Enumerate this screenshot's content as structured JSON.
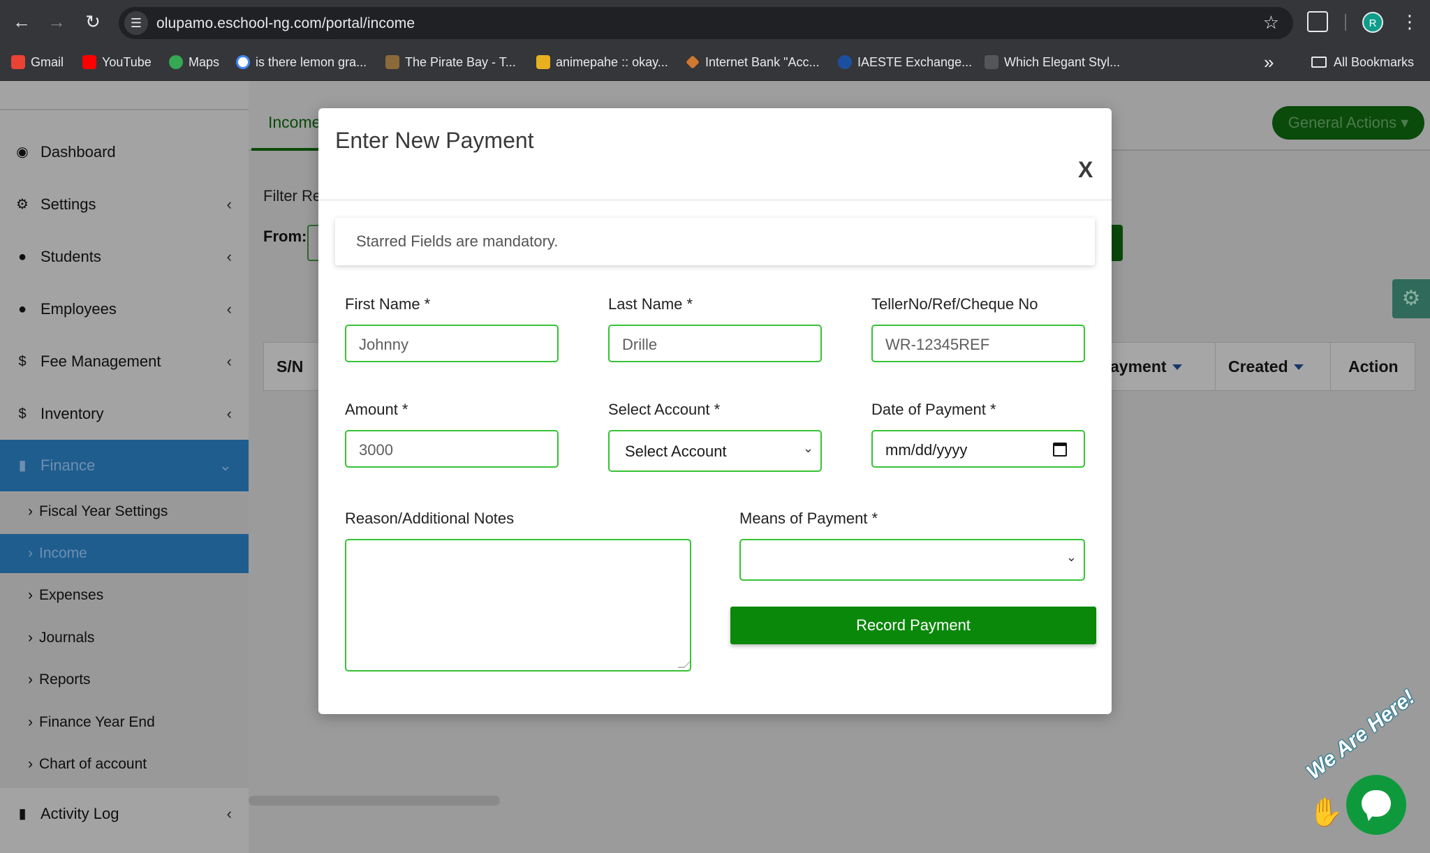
{
  "browser": {
    "url": "olupamo.eschool-ng.com/portal/income",
    "profile_initial": "R",
    "bookmarks": [
      {
        "label": "Gmail"
      },
      {
        "label": "YouTube"
      },
      {
        "label": "Maps"
      },
      {
        "label": "is there lemon gra..."
      },
      {
        "label": "The Pirate Bay - T..."
      },
      {
        "label": "animepahe :: okay..."
      },
      {
        "label": "Internet Bank \"Acc..."
      },
      {
        "label": "IAESTE Exchange..."
      },
      {
        "label": "Which Elegant Styl..."
      }
    ],
    "all_bookmarks": "All Bookmarks"
  },
  "sidebar": {
    "items": [
      {
        "label": "Dashboard",
        "icon": "dashboard-icon"
      },
      {
        "label": "Settings",
        "icon": "gear-icon"
      },
      {
        "label": "Students",
        "icon": "user-icon"
      },
      {
        "label": "Employees",
        "icon": "user-icon"
      },
      {
        "label": "Fee Management",
        "icon": "dollar-icon"
      },
      {
        "label": "Inventory",
        "icon": "dollar-icon"
      },
      {
        "label": "Finance",
        "icon": "book-icon"
      },
      {
        "label": "Activity Log",
        "icon": "book-icon"
      }
    ],
    "finance_sub": [
      {
        "label": "Fiscal Year Settings"
      },
      {
        "label": "Income"
      },
      {
        "label": "Expenses"
      },
      {
        "label": "Journals"
      },
      {
        "label": "Reports"
      },
      {
        "label": "Finance Year End"
      },
      {
        "label": "Chart of account"
      }
    ]
  },
  "main": {
    "tab_label": "Income",
    "general_actions": "General Actions",
    "filter_label": "Filter Re",
    "from_label": "From:",
    "table_headers": {
      "sn": "S/N",
      "payment": "ayment",
      "created": "Created",
      "action": "Action"
    }
  },
  "modal": {
    "title": "Enter New Payment",
    "close": "X",
    "notice": "Starred Fields are mandatory.",
    "first_name_label": "First Name *",
    "first_name_value": "Johnny",
    "last_name_label": "Last Name *",
    "last_name_value": "Drille",
    "teller_label": "TellerNo/Ref/Cheque No",
    "teller_value": "WR-12345REF",
    "amount_label": "Amount *",
    "amount_value": "3000",
    "account_label": "Select Account *",
    "account_value": "Select Account",
    "date_label": "Date of Payment *",
    "date_value": "mm/dd/yyyy",
    "notes_label": "Reason/Additional Notes",
    "notes_value": "",
    "means_label": "Means of Payment *",
    "means_value": "",
    "record_button": "Record Payment"
  },
  "chat_widget": {
    "banner": "We Are Here!"
  },
  "colors": {
    "accent_green": "#0a880a",
    "input_border": "#35c335",
    "sidebar_active": "#1f5d8f"
  }
}
